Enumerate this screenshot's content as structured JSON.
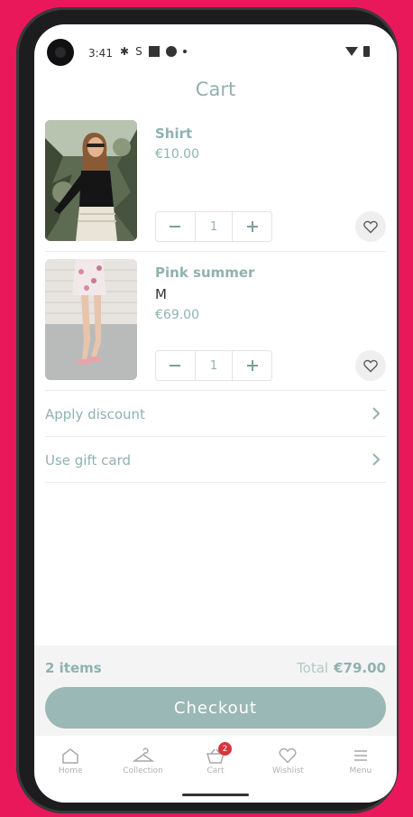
{
  "status": {
    "time": "3:41"
  },
  "header": {
    "title": "Cart"
  },
  "items": [
    {
      "name": "Shirt",
      "size": "",
      "price": "€10.00",
      "qty": "1"
    },
    {
      "name": "Pink summer",
      "size": "M",
      "price": "€69.00",
      "qty": "1"
    }
  ],
  "options": [
    {
      "label": "Apply discount"
    },
    {
      "label": "Use gift card"
    }
  ],
  "summary": {
    "count": "2 items",
    "total_label": "Total",
    "total_value": "€79.00",
    "checkout_label": "Checkout"
  },
  "nav": {
    "items": [
      {
        "label": "Home",
        "icon": "home-icon"
      },
      {
        "label": "Collection",
        "icon": "hanger-icon"
      },
      {
        "label": "Cart",
        "icon": "basket-icon",
        "badge": "2"
      },
      {
        "label": "Wishlist",
        "icon": "heart-icon"
      },
      {
        "label": "Menu",
        "icon": "menu-icon"
      }
    ]
  },
  "colors": {
    "accent": "#8fb2b0",
    "button": "#9ab8b5",
    "badge": "#d9343b",
    "background": "#e8185a"
  }
}
